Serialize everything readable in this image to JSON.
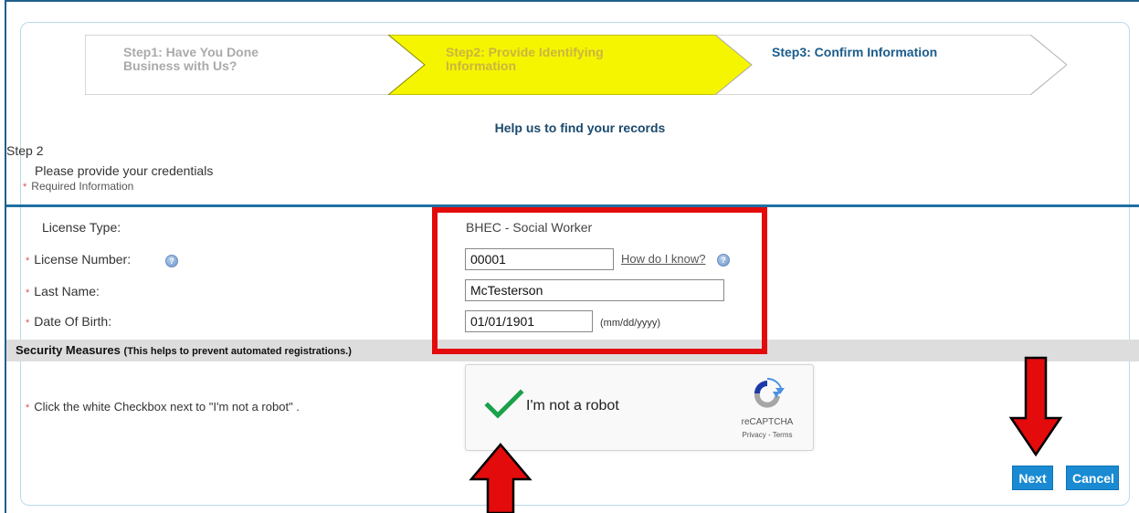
{
  "wizard": {
    "step1": {
      "line1": "Step1: Have You Done",
      "line2": "Business with Us?"
    },
    "step2": {
      "line1": "Step2: Provide Identifying",
      "line2": "Information"
    },
    "step3": {
      "line1": "Step3: Confirm Information"
    }
  },
  "header": {
    "help_title": "Help us to find your records",
    "step_name": "Step 2",
    "credentials_text": "Please provide your credentials",
    "required_star": "*",
    "required_text": "Required Information"
  },
  "form": {
    "license_type": {
      "label": "License Type:",
      "value": "BHEC - Social Worker"
    },
    "license_number": {
      "star": "*",
      "label": "License Number:",
      "value": "00001",
      "help_link": "How do I know?"
    },
    "last_name": {
      "star": "*",
      "label": "Last Name:",
      "value": "McTesterson"
    },
    "date_of_birth": {
      "star": "*",
      "label": "Date Of Birth:",
      "value": "01/01/1901",
      "hint": "(mm/dd/yyyy)"
    }
  },
  "security": {
    "title": "Security Measures",
    "subtitle": "(This helps to prevent automated registrations.)",
    "star": "*",
    "captcha_instruction": "Click the white Checkbox next to \"I'm not a robot\" .",
    "captcha_text": "I'm not a robot",
    "captcha_brand": "reCAPTCHA",
    "captcha_links": "Privacy - Terms",
    "checked": true
  },
  "buttons": {
    "next": "Next",
    "cancel": "Cancel"
  },
  "icons": {
    "info": "info-icon",
    "check": "check-icon",
    "recaptcha_logo": "recaptcha-logo",
    "arrow": "red-arrow"
  },
  "colors": {
    "active_step": "#f5f500",
    "highlight": "#e30b0b",
    "button": "#1a8bd3",
    "rule": "#1f6fa3"
  }
}
